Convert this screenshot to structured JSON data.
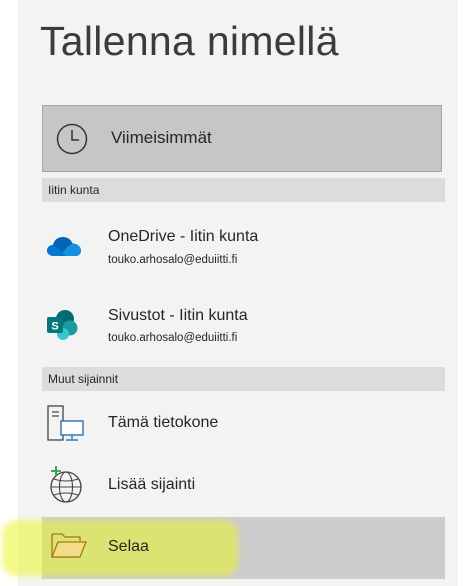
{
  "title": "Tallenna nimellä",
  "recent": {
    "label": "Viimeisimmät",
    "icon": "clock-icon"
  },
  "sections": [
    {
      "header": "Iitin kunta",
      "items": [
        {
          "name": "OneDrive - Iitin kunta",
          "account": "touko.arhosalo@eduiitti.fi",
          "icon": "onedrive-cloud-icon",
          "color": "#0364b8"
        },
        {
          "name": "Sivustot - Iitin kunta",
          "account": "touko.arhosalo@eduiitti.fi",
          "icon": "sharepoint-icon",
          "color": "#038387"
        }
      ]
    },
    {
      "header": "Muut sijainnit",
      "items": [
        {
          "name": "Tämä tietokone",
          "icon": "computer-icon"
        },
        {
          "name": "Lisää sijainti",
          "icon": "globe-add-icon"
        },
        {
          "name": "Selaa",
          "icon": "folder-icon",
          "highlighted": true
        }
      ]
    }
  ]
}
